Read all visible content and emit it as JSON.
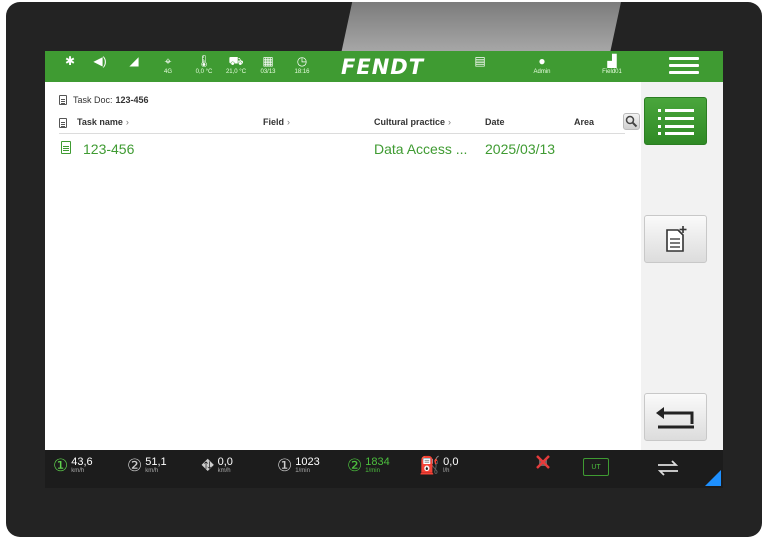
{
  "status_bar": {
    "items": [
      {
        "icon": "bluetooth-icon",
        "glyph": "✱",
        "label": ""
      },
      {
        "icon": "volume-icon",
        "glyph": "◀)",
        "label": ""
      },
      {
        "icon": "signal-icon",
        "glyph": "◢",
        "label": ""
      },
      {
        "icon": "gps-icon",
        "glyph": "⌖",
        "label": "4G"
      },
      {
        "icon": "thermometer-icon",
        "glyph": "🌡",
        "label": "0,0 °C"
      },
      {
        "icon": "tractor-temp-icon",
        "glyph": "⛟",
        "label": "21,0 °C"
      },
      {
        "icon": "calendar-icon",
        "glyph": "▦",
        "label": "03/13"
      },
      {
        "icon": "clock-icon",
        "glyph": "◷",
        "label": "18:16"
      }
    ],
    "brand": "FENDT",
    "doc_icon": "document-icon",
    "user_label": "Admin",
    "field_label": "Field01",
    "menu_icon": "hamburger-menu-icon"
  },
  "task_doc": {
    "label": "Task Doc:",
    "name": "123-456"
  },
  "table": {
    "headers": [
      "Task name",
      "Field",
      "Cultural practice",
      "Date",
      "Area"
    ],
    "rows": [
      {
        "task_name": "123-456",
        "field": "",
        "cultural_practice": "Data Access ...",
        "date": "2025/03/13",
        "area": ""
      }
    ]
  },
  "side_buttons": [
    {
      "icon": "list-view-icon",
      "active": true
    },
    {
      "icon": "new-document-icon",
      "active": false
    },
    {
      "icon": "back-arrow-icon",
      "active": false
    }
  ],
  "bottom_bar": [
    {
      "icon": "speed-1-icon",
      "glyph": "①",
      "value": "43,6",
      "unit": "km/h"
    },
    {
      "icon": "speed-2-icon",
      "glyph": "②",
      "value": "51,1",
      "unit": "km/h"
    },
    {
      "icon": "ground-speed-icon",
      "glyph": "⛖",
      "value": "0,0",
      "unit": "km/h"
    },
    {
      "icon": "pto-1-icon",
      "glyph": "①",
      "value": "1023",
      "unit": "1/min"
    },
    {
      "icon": "pto-2-icon",
      "glyph": "②",
      "value": "1834",
      "unit": "1/min"
    },
    {
      "icon": "fuel-icon",
      "glyph": "⛽",
      "value": "0,0",
      "unit": "l/h"
    }
  ],
  "bottom_right": {
    "warning_icon": "disconnected-icon",
    "ut_label": "UT",
    "swap_icon": "swap-arrows-icon"
  },
  "colors": {
    "brand_green": "#3f9b32",
    "highlight_green": "#4cbf3e",
    "bezel": "#232323",
    "corner_accent": "#1e90ff"
  }
}
